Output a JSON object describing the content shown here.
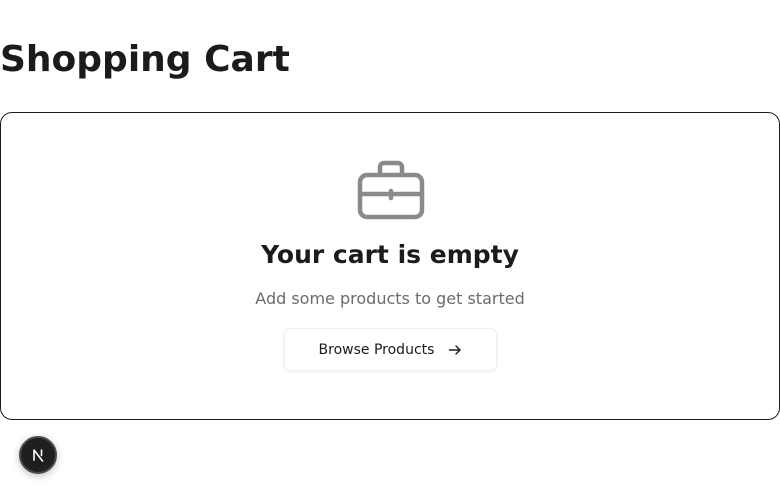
{
  "page": {
    "title": "Shopping Cart"
  },
  "empty_state": {
    "icon": "briefcase-icon",
    "heading": "Your cart is empty",
    "subtext": "Add some products to get started",
    "button_label": "Browse Products",
    "button_icon": "arrow-right-icon"
  },
  "dev_badge": {
    "icon": "nextjs-logo-icon"
  },
  "colors": {
    "text": "#1b1b1b",
    "muted": "#6b6b6b",
    "icon": "#8a8a8a",
    "badge_bg": "#1f1f1f"
  }
}
